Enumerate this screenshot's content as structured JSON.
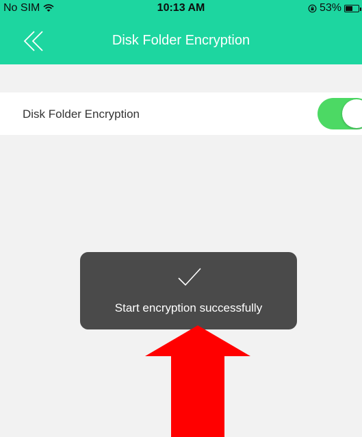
{
  "status_bar": {
    "carrier": "No SIM",
    "time": "10:13 AM",
    "battery": "53%",
    "battery_level": 0.53
  },
  "nav": {
    "back_icon": "double-chevron-left-icon",
    "title": "Disk Folder Encryption"
  },
  "settings": {
    "encryption_label": "Disk Folder Encryption",
    "encryption_enabled": true
  },
  "toast": {
    "icon": "checkmark-icon",
    "message": "Start encryption successfully"
  },
  "annotation": {
    "icon": "red-up-arrow",
    "color": "#ff0000"
  },
  "colors": {
    "header": "#1dd6a0",
    "toggle_on": "#4cd964",
    "toast_bg": "#4a4a4a"
  }
}
